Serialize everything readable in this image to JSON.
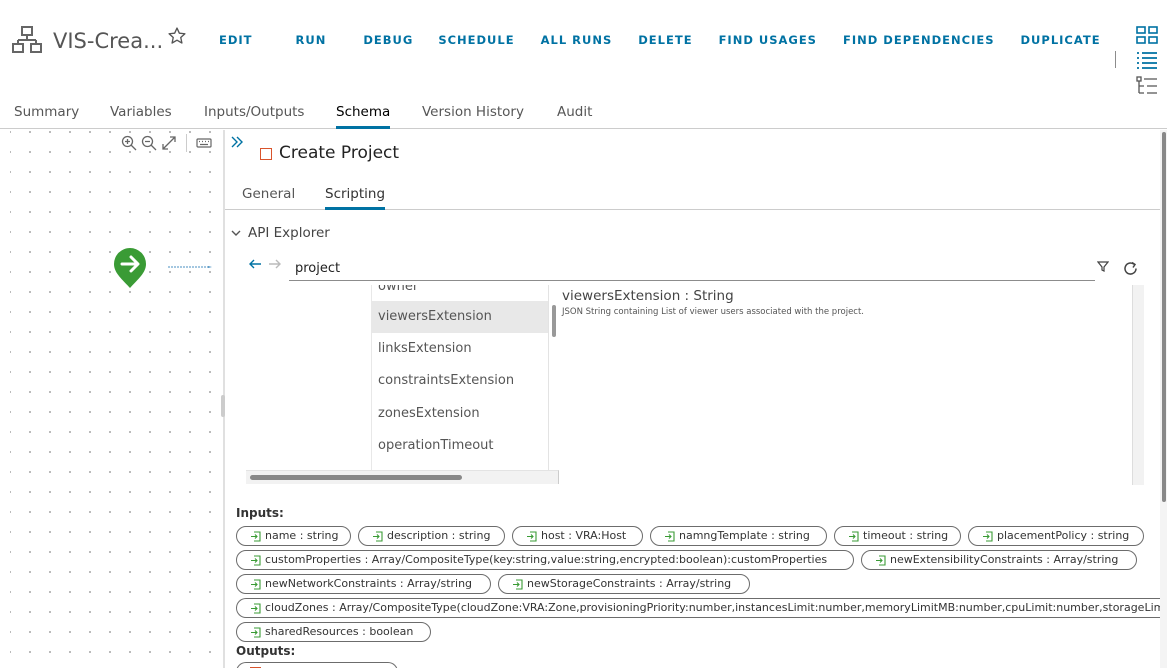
{
  "header": {
    "workflow_title": "VIS-Crea...",
    "actions": [
      "EDIT",
      "RUN",
      "DEBUG",
      "SCHEDULE",
      "ALL RUNS",
      "DELETE",
      "FIND USAGES",
      "FIND DEPENDENCIES",
      "DUPLICATE"
    ],
    "view_icons": [
      "grid-view-icon",
      "list-view-icon",
      "tree-view-icon"
    ]
  },
  "tabs": [
    "Summary",
    "Variables",
    "Inputs/Outputs",
    "Schema",
    "Version History",
    "Audit"
  ],
  "active_tab": "Schema",
  "canvas": {
    "toolbar_icons": [
      "zoom-in-icon",
      "zoom-out-icon",
      "fit-screen-icon",
      "keyboard-icon"
    ]
  },
  "element": {
    "title": "Create Project",
    "subtabs": [
      "General",
      "Scripting"
    ],
    "active_subtab": "Scripting"
  },
  "api_explorer": {
    "label": "API Explorer",
    "search_value": "project",
    "tree_items": [
      "owner",
      "viewersExtension",
      "linksExtension",
      "constraintsExtension",
      "zonesExtension",
      "operationTimeout"
    ],
    "selected_item": "viewersExtension",
    "detail_title": "viewersExtension : String",
    "detail_description": "JSON String containing List of viewer users associated with the project."
  },
  "inputs_label": "Inputs:",
  "outputs_label": "Outputs:",
  "inputs": [
    "name : string",
    "description : string",
    "host : VRA:Host",
    "namngTemplate : string",
    "timeout : string",
    "placementPolicy : string",
    "customProperties : Array/CompositeType(key:string,value:string,encrypted:boolean):customProperties",
    "newExtensibilityConstraints : Array/string",
    "newNetworkConstraints : Array/string",
    "newStorageConstraints : Array/string",
    "cloudZones : Array/CompositeType(cloudZone:VRA:Zone,provisioningPriority:number,instancesLimit:number,memoryLimitMB:number,cpuLimit:number,storageLimitGB:number)",
    "sharedResources : boolean"
  ],
  "colors": {
    "accent": "#0072a3",
    "start_node": "#3a9b35",
    "task_icon": "#d9542c"
  }
}
